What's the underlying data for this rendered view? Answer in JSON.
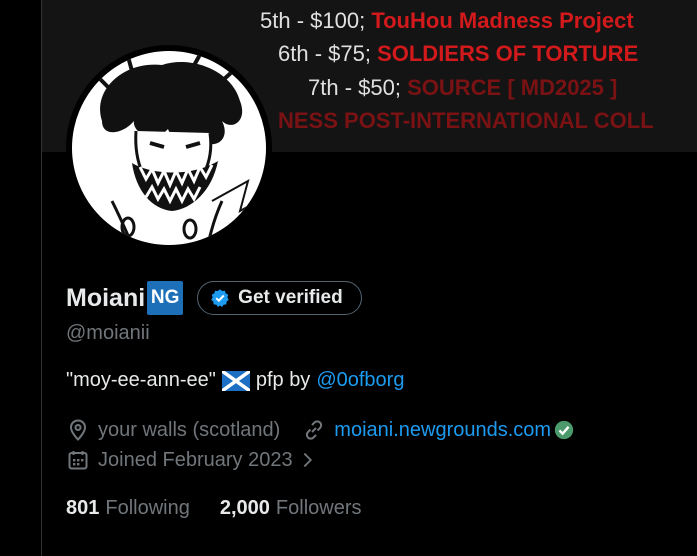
{
  "banner": {
    "lines": [
      {
        "place": "5th - $100;",
        "prize": "TouHou Madness Project"
      },
      {
        "place": "6th - $75;",
        "prize": "SOLDIERS OF TORTURE"
      },
      {
        "place": "7th - $50;",
        "prize": "SOURCE [ MD2025 ]"
      },
      {
        "place": "",
        "prize": "NESS POST-INTERNATIONAL COLL"
      }
    ]
  },
  "profile": {
    "display_name": "Moiani",
    "badge": "NG",
    "verify_label": "Get verified",
    "handle": "@moianii",
    "bio_text": "\"moy-ee-ann-ee\"",
    "bio_pfp": "pfp by",
    "bio_mention": "@0ofborg",
    "location": "your walls (scotland)",
    "website": "moiani.newgrounds.com",
    "joined": "Joined February 2023",
    "following_count": "801",
    "following_label": "Following",
    "followers_count": "2,000",
    "followers_label": "Followers"
  },
  "icons": {
    "location": "location-pin-icon",
    "link": "link-icon",
    "calendar": "calendar-icon",
    "verified": "verified-check-icon",
    "chevron": "chevron-right-icon",
    "flag": "scotland-flag-icon"
  },
  "colors": {
    "accent": "#1d9bf0",
    "muted": "#71767b",
    "text": "#e7e9ea",
    "banner_red": "#d2191b",
    "ng_badge": "#1d6fb8",
    "site_verified": "#4c9a6c"
  }
}
